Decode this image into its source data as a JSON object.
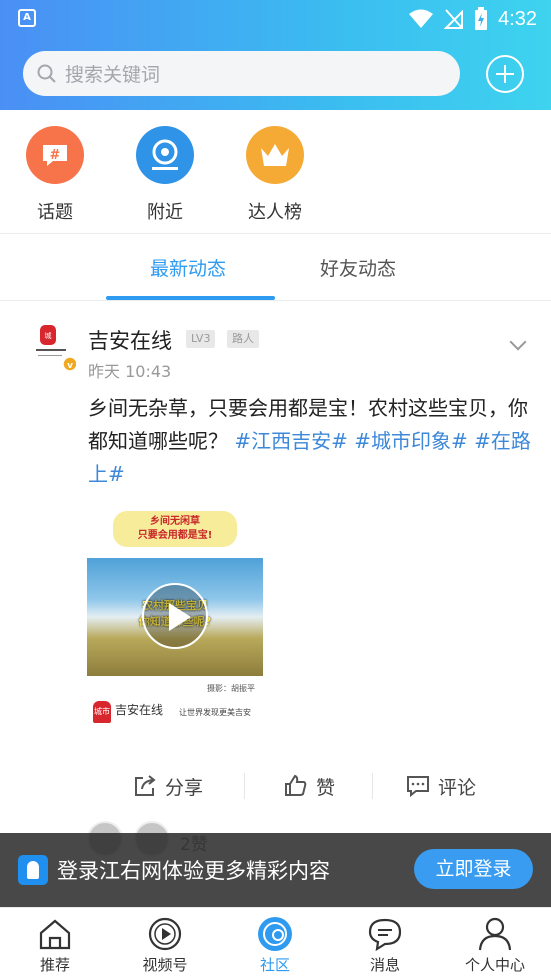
{
  "status_bar": {
    "time": "4:32",
    "app_icon_label": "A"
  },
  "search": {
    "placeholder": "搜索关键词"
  },
  "quick_links": [
    {
      "label": "话题",
      "icon": "hashtag-icon",
      "color": "#f7734a"
    },
    {
      "label": "附近",
      "icon": "location-icon",
      "color": "#2f94e8"
    },
    {
      "label": "达人榜",
      "icon": "crown-icon",
      "color": "#f6aa36"
    }
  ],
  "tabs": [
    {
      "label": "最新动态",
      "active": true
    },
    {
      "label": "好友动态",
      "active": false
    }
  ],
  "post": {
    "author": "吉安在线",
    "level_badge": "LV3",
    "role_badge": "路人",
    "time": "昨天 10:43",
    "text": "乡间无杂草，只要会用都是宝！农村这些宝贝，你都知道哪些呢？",
    "tags": [
      "#江西吉安#",
      "#城市印象#",
      "#在路上#"
    ],
    "thumbnail": {
      "banner_line1": "乡间无闲草",
      "banner_line2": "只要会用都是宝!",
      "overlay_line1": "农村那些宝贝",
      "overlay_line2": "你知道哪些呢?",
      "credit": "摄影：胡振平",
      "logo_mark": "城市",
      "logo_name": "吉安在线",
      "logo_slogan": "让世界发现更美吉安"
    },
    "actions": {
      "share": "分享",
      "like": "赞",
      "comment": "评论"
    },
    "likes_text": "2赞"
  },
  "login_banner": {
    "text": "登录江右网体验更多精彩内容",
    "button": "立即登录"
  },
  "bottom_nav": [
    {
      "label": "推荐",
      "icon": "home-icon",
      "active": false
    },
    {
      "label": "视频号",
      "icon": "video-icon",
      "active": false
    },
    {
      "label": "社区",
      "icon": "community-icon",
      "active": true
    },
    {
      "label": "消息",
      "icon": "message-icon",
      "active": false
    },
    {
      "label": "个人中心",
      "icon": "user-icon",
      "active": false
    }
  ],
  "colors": {
    "accent": "#2f9bf0",
    "tag": "#3d88d8",
    "header_start": "#4a8ff5",
    "header_end": "#3ed3ef"
  }
}
